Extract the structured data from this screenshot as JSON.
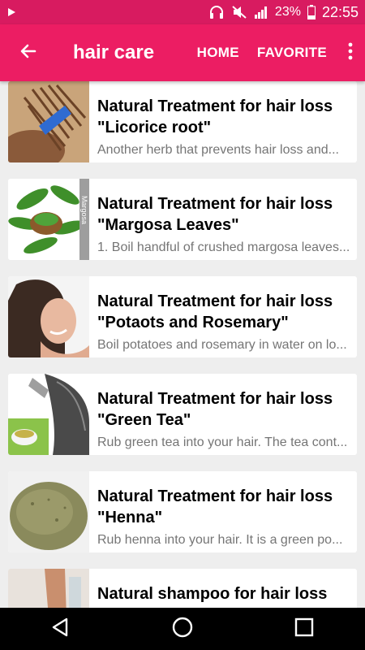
{
  "status_bar": {
    "battery_percent": "23%",
    "time": "22:55",
    "icons": [
      "play-icon",
      "headphones-icon",
      "mute-icon",
      "signal-icon",
      "battery-icon"
    ]
  },
  "app_bar": {
    "title": "hair care",
    "home_label": "HOME",
    "favorite_label": "FAVORITE",
    "icons": [
      "back-arrow-icon",
      "overflow-menu-icon"
    ]
  },
  "colors": {
    "status_bar": "#d81b60",
    "app_bar": "#ec1d63",
    "background": "#eeeeee"
  },
  "articles": [
    {
      "title": "Natural Treatment for hair loss\n\"Licorice root\"",
      "description": " Another herb that prevents hair loss and..."
    },
    {
      "title": "Natural Treatment for hair loss\n\"Margosa Leaves\"",
      "description": "1. Boil handful of crushed margosa leaves...",
      "image_label": "Margosa"
    },
    {
      "title": "Natural Treatment for hair loss\n\"Potaots and Rosemary\"",
      "description": "Boil potatoes and rosemary in water on lo..."
    },
    {
      "title": "Natural Treatment for hair loss\n\"Green Tea\"",
      "description": "Rub green tea into your hair. The tea cont..."
    },
    {
      "title": "Natural Treatment  for hair loss\n\"Henna\"",
      "description": "Rub  henna into your hair. It is a green po..."
    },
    {
      "title": "Natural shampoo for hair loss",
      "description": ""
    }
  ],
  "nav_bar": {
    "icons": [
      "back-triangle-icon",
      "home-circle-icon",
      "recents-square-icon"
    ]
  }
}
